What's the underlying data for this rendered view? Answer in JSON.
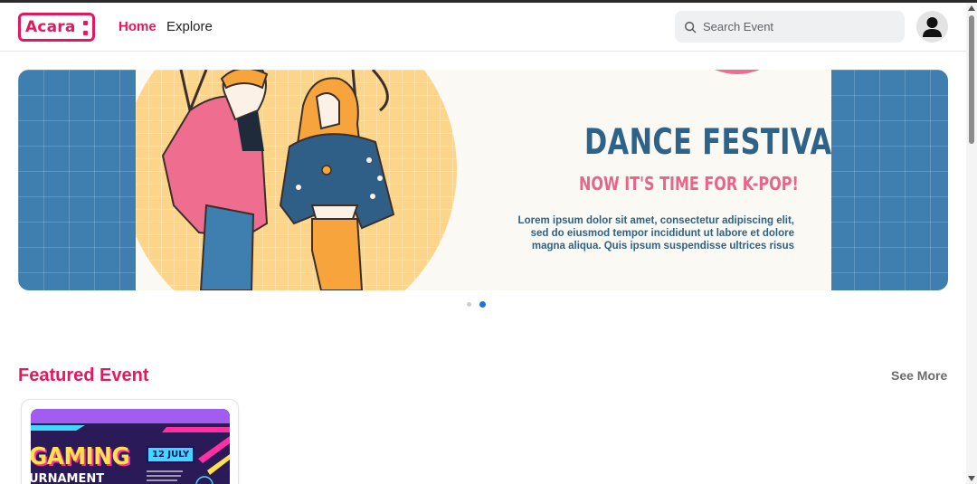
{
  "header": {
    "logo_text": "Acara",
    "nav": {
      "home": "Home",
      "explore": "Explore"
    },
    "search": {
      "placeholder": "Search Event",
      "value": ""
    }
  },
  "banner": {
    "title": "DANCE FESTIVAL",
    "subtitle": "NOW IT'S TIME FOR K-POP!",
    "body": "Lorem ipsum dolor sit amet, consectetur adipiscing elit, sed do eiusmod tempor incididunt ut labore et dolore magna aliqua. Quis ipsum suspendisse ultrices risus",
    "slide_count": 2,
    "active_slide": 2
  },
  "featured": {
    "title": "Featured Event",
    "see_more": "See More",
    "cards": [
      {
        "image_word": "GAMING",
        "image_date": "12 JULY",
        "image_sub": "URNAMENT"
      }
    ]
  },
  "colors": {
    "brand": "#e8175d",
    "banner_blue": "#3f7fb0",
    "dot_active": "#1e72d9"
  },
  "icons": {
    "search": "search-icon",
    "avatar": "user-avatar-icon"
  }
}
